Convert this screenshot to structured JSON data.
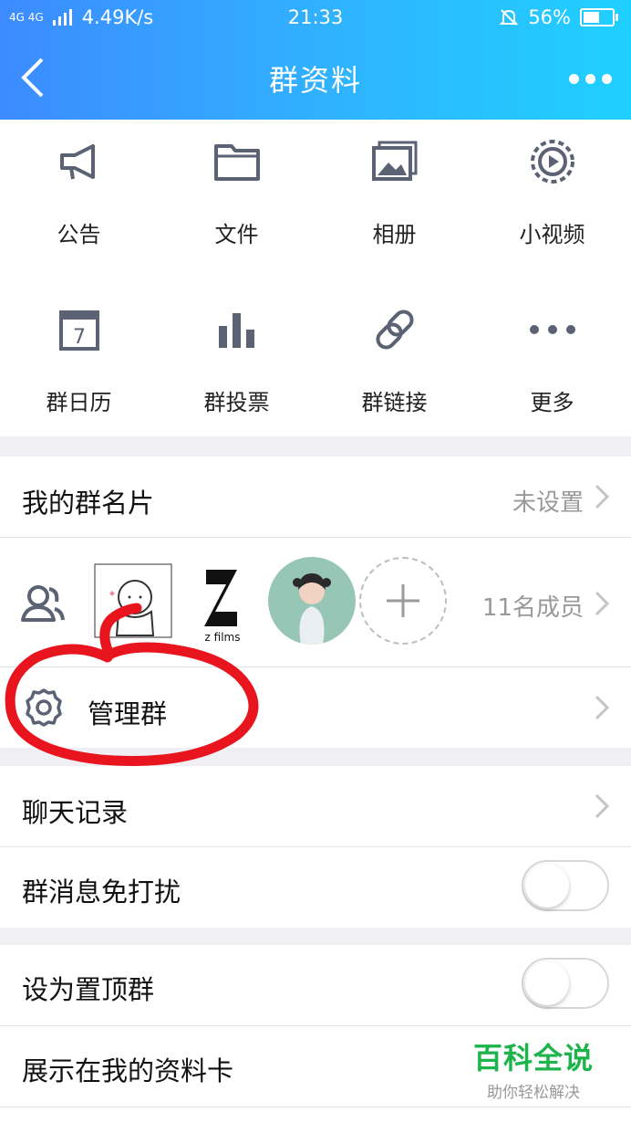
{
  "status_bar": {
    "network": "4G 4G",
    "speed": "4.49K/s",
    "time": "21:33",
    "battery": "56%",
    "battery_level": 0.56
  },
  "nav": {
    "title": "群资料"
  },
  "features": [
    {
      "label": "公告",
      "icon": "megaphone-icon"
    },
    {
      "label": "文件",
      "icon": "folder-icon"
    },
    {
      "label": "相册",
      "icon": "photo-album-icon"
    },
    {
      "label": "小视频",
      "icon": "video-play-icon"
    },
    {
      "label": "群日历",
      "icon": "calendar-icon"
    },
    {
      "label": "群投票",
      "icon": "bar-chart-icon"
    },
    {
      "label": "群链接",
      "icon": "link-icon"
    },
    {
      "label": "更多",
      "icon": "more-dots-icon"
    }
  ],
  "group_card": {
    "label": "我的群名片",
    "value": "未设置"
  },
  "members": {
    "count_label": "11名成员",
    "avatar2_text": "z films"
  },
  "manage": {
    "label": "管理群"
  },
  "chat_history": {
    "label": "聊天记录"
  },
  "mute": {
    "label": "群消息免打扰",
    "on": false
  },
  "pin": {
    "label": "设为置顶群",
    "on": false
  },
  "show_card": {
    "label": "展示在我的资料卡"
  },
  "watermark": {
    "title": "百科全说",
    "subtitle": "助你轻松解决"
  },
  "colors": {
    "header_start": "#3d8bff",
    "header_end": "#1fd0ff",
    "annotation_red": "#e8141e",
    "watermark_green": "#1db44b"
  }
}
